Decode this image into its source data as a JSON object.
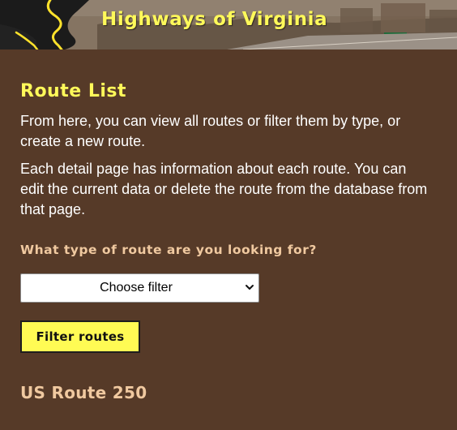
{
  "header": {
    "site_title": "Highways of Virginia"
  },
  "main": {
    "page_title": "Route List",
    "intro_1": "From here, you can view all routes or filter them by type, or create a new route.",
    "intro_2": "Each detail page has information about each route. You can edit the current data or delete the route from the database from that page.",
    "filter_question": "What type of route are you looking for?",
    "filter_select": {
      "selected": "Choose filter"
    },
    "filter_button_label": "Filter routes",
    "routes": [
      {
        "name": "US Route 250"
      }
    ]
  },
  "colors": {
    "background": "#563a28",
    "title_yellow": "#fff95a",
    "accent_tan": "#f0c9a0",
    "button_yellow": "#fffb54"
  }
}
